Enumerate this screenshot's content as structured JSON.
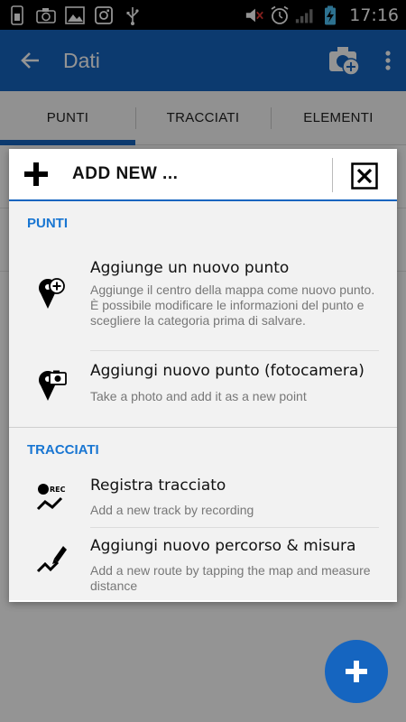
{
  "statusbar": {
    "time": "17:16",
    "left_icons": [
      "sim-icon",
      "camera-icon",
      "gallery-icon",
      "instagram-icon",
      "usb-icon"
    ],
    "right_icons": [
      "mute-icon",
      "alarm-icon",
      "signal-icon",
      "battery-charging-icon"
    ]
  },
  "appbar": {
    "title": "Dati",
    "color": "#1565c0"
  },
  "tabs": [
    {
      "label": "PUNTI",
      "active": true
    },
    {
      "label": "TRACCIATI",
      "active": false
    },
    {
      "label": "ELEMENTI",
      "active": false
    }
  ],
  "dialog": {
    "title": "ADD NEW ...",
    "sections": [
      {
        "title": "PUNTI",
        "items": [
          {
            "icon": "add-point-icon",
            "title": "Aggiunge un nuovo punto",
            "description": "Aggiunge il centro della mappa come nuovo punto. È possibile modificare le informazioni del punto e scegliere la categoria prima di salvare."
          },
          {
            "icon": "camera-point-icon",
            "title": "Aggiungi nuovo punto (fotocamera)",
            "description": "Take a photo and add it as a new point"
          }
        ]
      },
      {
        "title": "TRACCIATI",
        "items": [
          {
            "icon": "record-track-icon",
            "badge": "REC",
            "title": "Registra tracciato",
            "description": "Add a new track by recording"
          },
          {
            "icon": "draw-route-icon",
            "title": "Aggiungi nuovo percorso & misura",
            "description": "Add a new route by tapping the map and measure distance"
          }
        ]
      }
    ]
  },
  "colors": {
    "accent": "#1565c0",
    "section_title": "#1976d2"
  }
}
